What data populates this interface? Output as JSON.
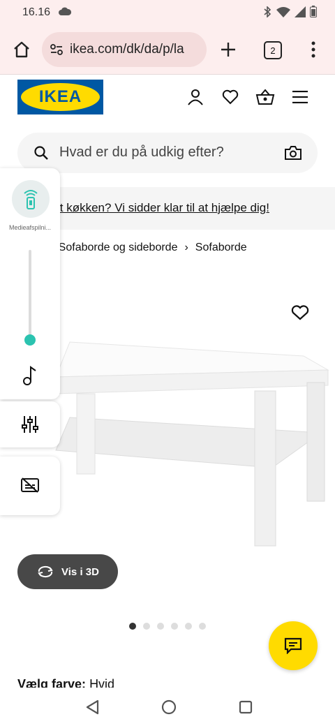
{
  "status": {
    "time": "16.16"
  },
  "browser": {
    "url": "ikea.com/dk/da/p/la",
    "tab_count": "2"
  },
  "header": {
    "logo_text": "IKEA"
  },
  "search": {
    "placeholder": "Hvad er du på udkig efter?"
  },
  "banner": {
    "text": "Nyt køkken? Vi sidder klar til at hjælpe dig!"
  },
  "breadcrumb": {
    "ellipsis": "...",
    "items": [
      "Sofaborde og sideborde",
      "Sofaborde"
    ]
  },
  "media_panel": {
    "label": "Medieafspilni...",
    "volume_level": 0.1
  },
  "product": {
    "view_3d_label": "Vis i 3D",
    "carousel": {
      "count": 6,
      "active_index": 0
    }
  },
  "color": {
    "label": "Vælg farve:",
    "value": "Hvid"
  },
  "colors": {
    "brand_blue": "#0058a3",
    "brand_yellow": "#ffdb00",
    "accent_teal": "#2bc3b0",
    "dark_button": "#484848"
  }
}
